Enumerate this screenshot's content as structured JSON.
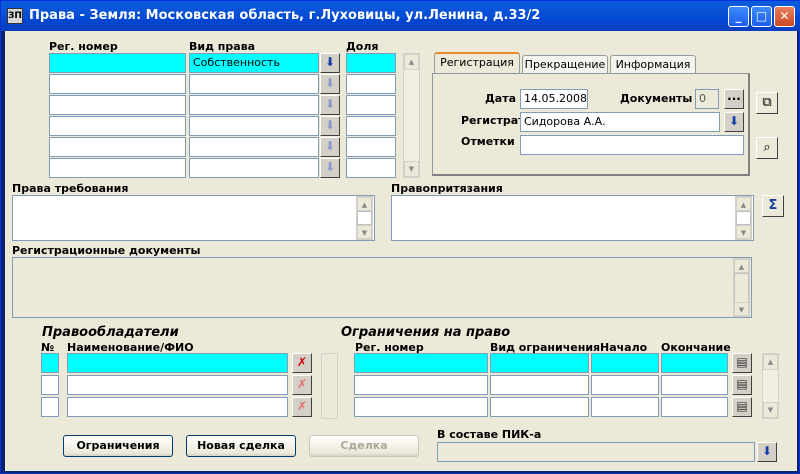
{
  "window": {
    "icon": "ЗП",
    "title": "Права - Земля: Московская область, г.Луховицы, ул.Ленина, д.33/2",
    "min": "_",
    "max": "□",
    "close": "✕"
  },
  "rights": {
    "col_reg": "Рег. номер",
    "col_kind": "Вид права",
    "col_share": "Доля",
    "rows": [
      {
        "reg": "",
        "kind": "Собственность",
        "share": ""
      },
      {
        "reg": "",
        "kind": "",
        "share": ""
      },
      {
        "reg": "",
        "kind": "",
        "share": ""
      },
      {
        "reg": "",
        "kind": "",
        "share": ""
      },
      {
        "reg": "",
        "kind": "",
        "share": ""
      },
      {
        "reg": "",
        "kind": "",
        "share": ""
      }
    ]
  },
  "tabs": {
    "items": [
      "Регистрация",
      "Прекращение",
      "Информация"
    ],
    "active": 0
  },
  "registration": {
    "date_label": "Дата",
    "date": "14.05.2008",
    "docs_label": "Документы",
    "docs_count": "0",
    "more": "...",
    "registrar_label": "Регистратор",
    "registrar": "Сидорова А.А.",
    "notes_label": "Отметки",
    "notes": ""
  },
  "claims": {
    "label": "Права требования",
    "value": ""
  },
  "pretensions": {
    "label": "Правопритязания",
    "value": ""
  },
  "regdocs": {
    "label": "Регистрационные документы",
    "value": ""
  },
  "holders": {
    "section": "Правообладатели",
    "col_num": "№",
    "col_name": "Наименование/ФИО",
    "rows": [
      {
        "num": "",
        "name": ""
      },
      {
        "num": "",
        "name": ""
      },
      {
        "num": "",
        "name": ""
      }
    ]
  },
  "restrictions": {
    "section": "Ограничения на право",
    "col_reg": "Рег. номер",
    "col_kind": "Вид ограничения",
    "col_start": "Начало",
    "col_end": "Окончание",
    "rows": [
      {
        "reg": "",
        "kind": "",
        "start": "",
        "end": ""
      },
      {
        "reg": "",
        "kind": "",
        "start": "",
        "end": ""
      },
      {
        "reg": "",
        "kind": "",
        "start": "",
        "end": ""
      }
    ]
  },
  "buttons": {
    "restrictions": "Ограничения",
    "new_deal": "Новая сделка",
    "deal": "Сделка"
  },
  "pik": {
    "label": "В составе ПИК-а",
    "value": ""
  },
  "icons": {
    "dropdown": "download-arrow-icon",
    "copy": "copy-icon",
    "search": "magnifier-icon",
    "sum": "sigma-icon",
    "remove": "remove-person-icon",
    "doc": "document-icon"
  }
}
